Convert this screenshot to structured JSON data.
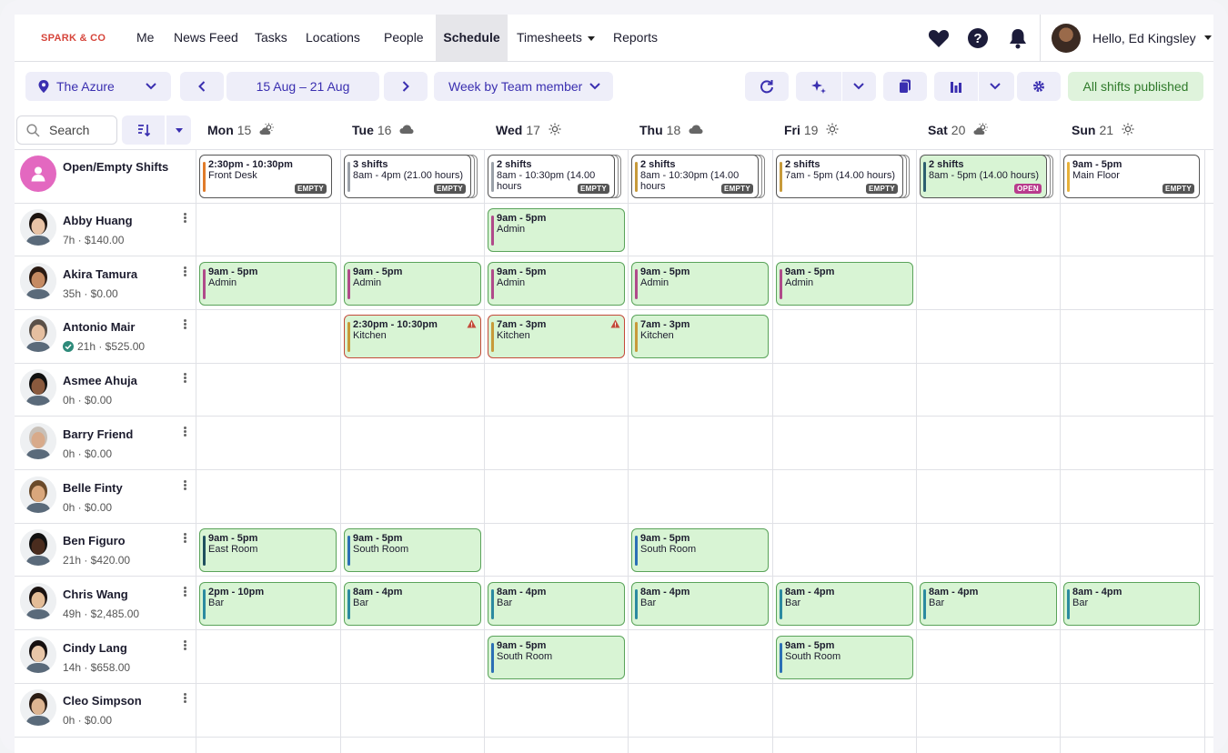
{
  "brand": {
    "name": "SPARK & CO"
  },
  "nav": {
    "items": [
      "Me",
      "News Feed",
      "Tasks",
      "Locations",
      "People",
      "Schedule",
      "Timesheets",
      "Reports"
    ],
    "active": "Schedule",
    "greeting": "Hello, Ed Kingsley"
  },
  "toolbar": {
    "location": "The Azure",
    "date_range": "15 Aug – 21 Aug",
    "view": "Week by Team member",
    "status": "All shifts published"
  },
  "search": {
    "placeholder": "Search"
  },
  "days": [
    {
      "name": "Mon",
      "num": "15",
      "weather": "partly-cloudy-icon"
    },
    {
      "name": "Tue",
      "num": "16",
      "weather": "cloud-icon"
    },
    {
      "name": "Wed",
      "num": "17",
      "weather": "sun-icon"
    },
    {
      "name": "Thu",
      "num": "18",
      "weather": "cloud-icon"
    },
    {
      "name": "Fri",
      "num": "19",
      "weather": "sun-icon"
    },
    {
      "name": "Sat",
      "num": "20",
      "weather": "partly-cloudy-icon"
    },
    {
      "name": "Sun",
      "num": "21",
      "weather": "sun-icon"
    }
  ],
  "open_row": {
    "label": "Open/Empty Shifts",
    "cells": [
      {
        "time": "2:30pm - 10:30pm",
        "area": "Front Desk",
        "badge": "EMPTY",
        "color": "#e07b2a"
      },
      {
        "time": "3 shifts",
        "area": "8am - 4pm (21.00 hours)",
        "badge": "EMPTY",
        "color": "#9aa0a8",
        "stack": true
      },
      {
        "time": "2 shifts",
        "area": "8am - 10:30pm (14.00 hours",
        "badge": "EMPTY",
        "color": "#9aa0a8",
        "stack": true
      },
      {
        "time": "2 shifts",
        "area": "8am - 10:30pm (14.00 hours",
        "badge": "EMPTY",
        "color": "#c79a3a",
        "stack": true
      },
      {
        "time": "2 shifts",
        "area": "7am - 5pm (14.00 hours)",
        "badge": "EMPTY",
        "color": "#c79a3a",
        "stack": true
      },
      {
        "time": "2 shifts",
        "area": "8am - 5pm (14.00 hours)",
        "badge": "OPEN",
        "color": "#2c5f6f",
        "stack": true,
        "green": true
      },
      {
        "time": "9am - 5pm",
        "area": "Main Floor",
        "badge": "EMPTY",
        "color": "#e8b23a"
      }
    ]
  },
  "members": [
    {
      "name": "Abby Huang",
      "meta": "7h · $140.00",
      "shifts": [
        null,
        null,
        {
          "time": "9am - 5pm",
          "area": "Admin",
          "color": "#b04a8a"
        },
        null,
        null,
        null,
        null
      ]
    },
    {
      "name": "Akira Tamura",
      "meta": "35h · $0.00",
      "shifts": [
        {
          "time": "9am - 5pm",
          "area": "Admin",
          "color": "#b04a8a"
        },
        {
          "time": "9am - 5pm",
          "area": "Admin",
          "color": "#b04a8a"
        },
        {
          "time": "9am - 5pm",
          "area": "Admin",
          "color": "#b04a8a"
        },
        {
          "time": "9am - 5pm",
          "area": "Admin",
          "color": "#b04a8a"
        },
        {
          "time": "9am - 5pm",
          "area": "Admin",
          "color": "#b04a8a"
        },
        null,
        null
      ]
    },
    {
      "name": "Antonio Mair",
      "meta": "21h · $525.00",
      "verified": true,
      "shifts": [
        null,
        {
          "time": "2:30pm - 10:30pm",
          "area": "Kitchen",
          "color": "#c79a3a",
          "warn": true
        },
        {
          "time": "7am - 3pm",
          "area": "Kitchen",
          "color": "#c79a3a",
          "warn": true
        },
        {
          "time": "7am - 3pm",
          "area": "Kitchen",
          "color": "#c79a3a"
        },
        null,
        null,
        null
      ]
    },
    {
      "name": "Asmee Ahuja",
      "meta": "0h · $0.00",
      "shifts": [
        null,
        null,
        null,
        null,
        null,
        null,
        null
      ]
    },
    {
      "name": "Barry Friend",
      "meta": "0h · $0.00",
      "shifts": [
        null,
        null,
        null,
        null,
        null,
        null,
        null
      ]
    },
    {
      "name": "Belle Finty",
      "meta": "0h · $0.00",
      "shifts": [
        null,
        null,
        null,
        null,
        null,
        null,
        null
      ]
    },
    {
      "name": "Ben Figuro",
      "meta": "21h · $420.00",
      "shifts": [
        {
          "time": "9am - 5pm",
          "area": "East Room",
          "color": "#1f4f5f"
        },
        {
          "time": "9am - 5pm",
          "area": "South Room",
          "color": "#2b6fb5"
        },
        null,
        {
          "time": "9am - 5pm",
          "area": "South Room",
          "color": "#2b6fb5"
        },
        null,
        null,
        null
      ]
    },
    {
      "name": "Chris Wang",
      "meta": "49h · $2,485.00",
      "shifts": [
        {
          "time": "2pm - 10pm",
          "area": "Bar",
          "color": "#2b8aa0"
        },
        {
          "time": "8am - 4pm",
          "area": "Bar",
          "color": "#2b8aa0"
        },
        {
          "time": "8am - 4pm",
          "area": "Bar",
          "color": "#2b8aa0"
        },
        {
          "time": "8am - 4pm",
          "area": "Bar",
          "color": "#2b8aa0"
        },
        {
          "time": "8am - 4pm",
          "area": "Bar",
          "color": "#2b8aa0"
        },
        {
          "time": "8am - 4pm",
          "area": "Bar",
          "color": "#2b8aa0"
        },
        {
          "time": "8am - 4pm",
          "area": "Bar",
          "color": "#2b8aa0"
        }
      ]
    },
    {
      "name": "Cindy Lang",
      "meta": "14h · $658.00",
      "shifts": [
        null,
        null,
        {
          "time": "9am - 5pm",
          "area": "South Room",
          "color": "#2b6fb5"
        },
        null,
        {
          "time": "9am - 5pm",
          "area": "South Room",
          "color": "#2b6fb5"
        },
        null,
        null
      ]
    },
    {
      "name": "Cleo Simpson",
      "meta": "0h · $0.00",
      "shifts": [
        null,
        null,
        null,
        null,
        null,
        null,
        null
      ]
    }
  ],
  "colors": {
    "accent": "#3a2fb0",
    "shift_bg": "#d8f4d4",
    "shift_border": "#5aa35a",
    "warn": "#c44a3a",
    "open_badge": "#b83b8c"
  }
}
